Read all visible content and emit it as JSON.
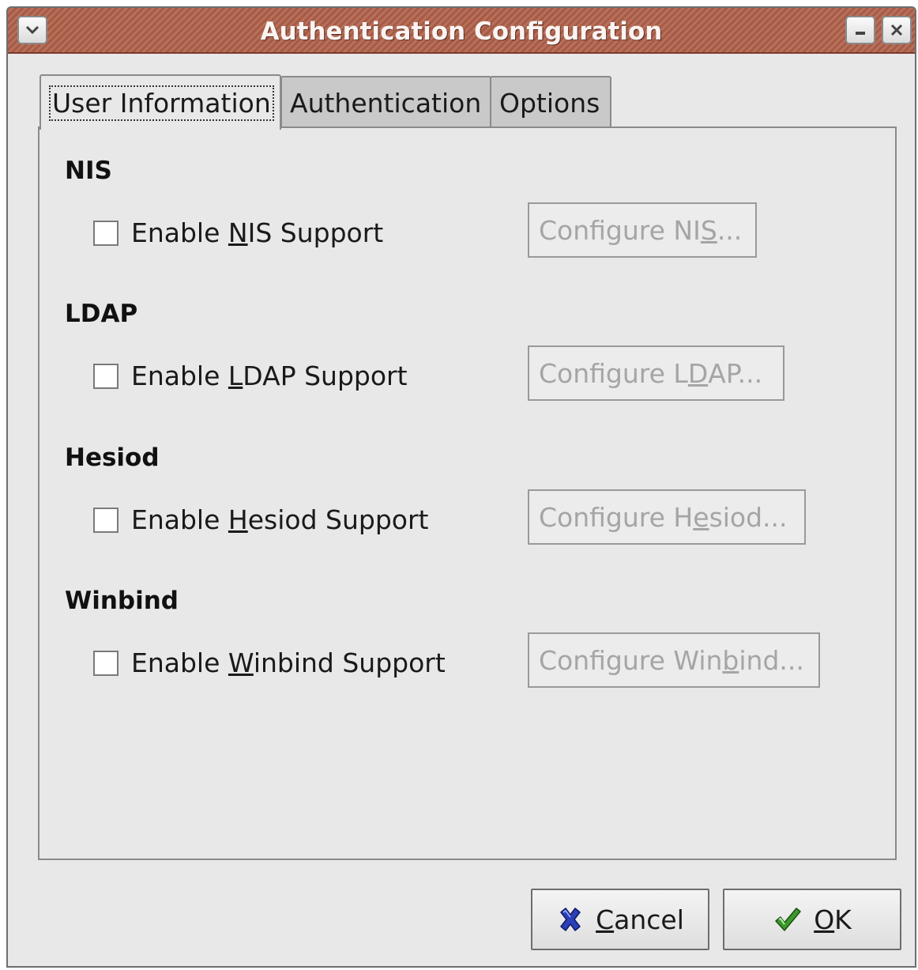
{
  "window": {
    "title": "Authentication Configuration"
  },
  "tabs": [
    {
      "label": "User Information",
      "active": true
    },
    {
      "label": "Authentication",
      "active": false
    },
    {
      "label": "Options",
      "active": false
    }
  ],
  "sections": [
    {
      "title": "NIS",
      "checkbox": {
        "pre": "Enable ",
        "mnemonic": "N",
        "post": "IS Support",
        "checked": false
      },
      "button": {
        "pre": "Configure NI",
        "mnemonic": "S",
        "post": "...",
        "enabled": false
      }
    },
    {
      "title": "LDAP",
      "checkbox": {
        "pre": "Enable ",
        "mnemonic": "L",
        "post": "DAP Support",
        "checked": false
      },
      "button": {
        "pre": "Configure L",
        "mnemonic": "D",
        "post": "AP...",
        "enabled": false
      }
    },
    {
      "title": "Hesiod",
      "checkbox": {
        "pre": "Enable ",
        "mnemonic": "H",
        "post": "esiod Support",
        "checked": false
      },
      "button": {
        "pre": "Configure H",
        "mnemonic": "e",
        "post": "siod...",
        "enabled": false
      }
    },
    {
      "title": "Winbind",
      "checkbox": {
        "pre": "Enable ",
        "mnemonic": "W",
        "post": "inbind Support",
        "checked": false
      },
      "button": {
        "pre": "Configure Win",
        "mnemonic": "b",
        "post": "ind...",
        "enabled": false
      }
    }
  ],
  "actions": {
    "cancel": {
      "mnemonic": "C",
      "rest": "ancel",
      "icon": "cancel-x-icon"
    },
    "ok": {
      "mnemonic": "O",
      "rest": "K",
      "icon": "checkmark-icon"
    }
  },
  "colors": {
    "titlebar": "#a55b46",
    "window_bg": "#e8e8e8",
    "disabled_text": "#a5a5a5",
    "cancel_icon": "#2b3fb8",
    "ok_icon": "#3a9a2a"
  }
}
